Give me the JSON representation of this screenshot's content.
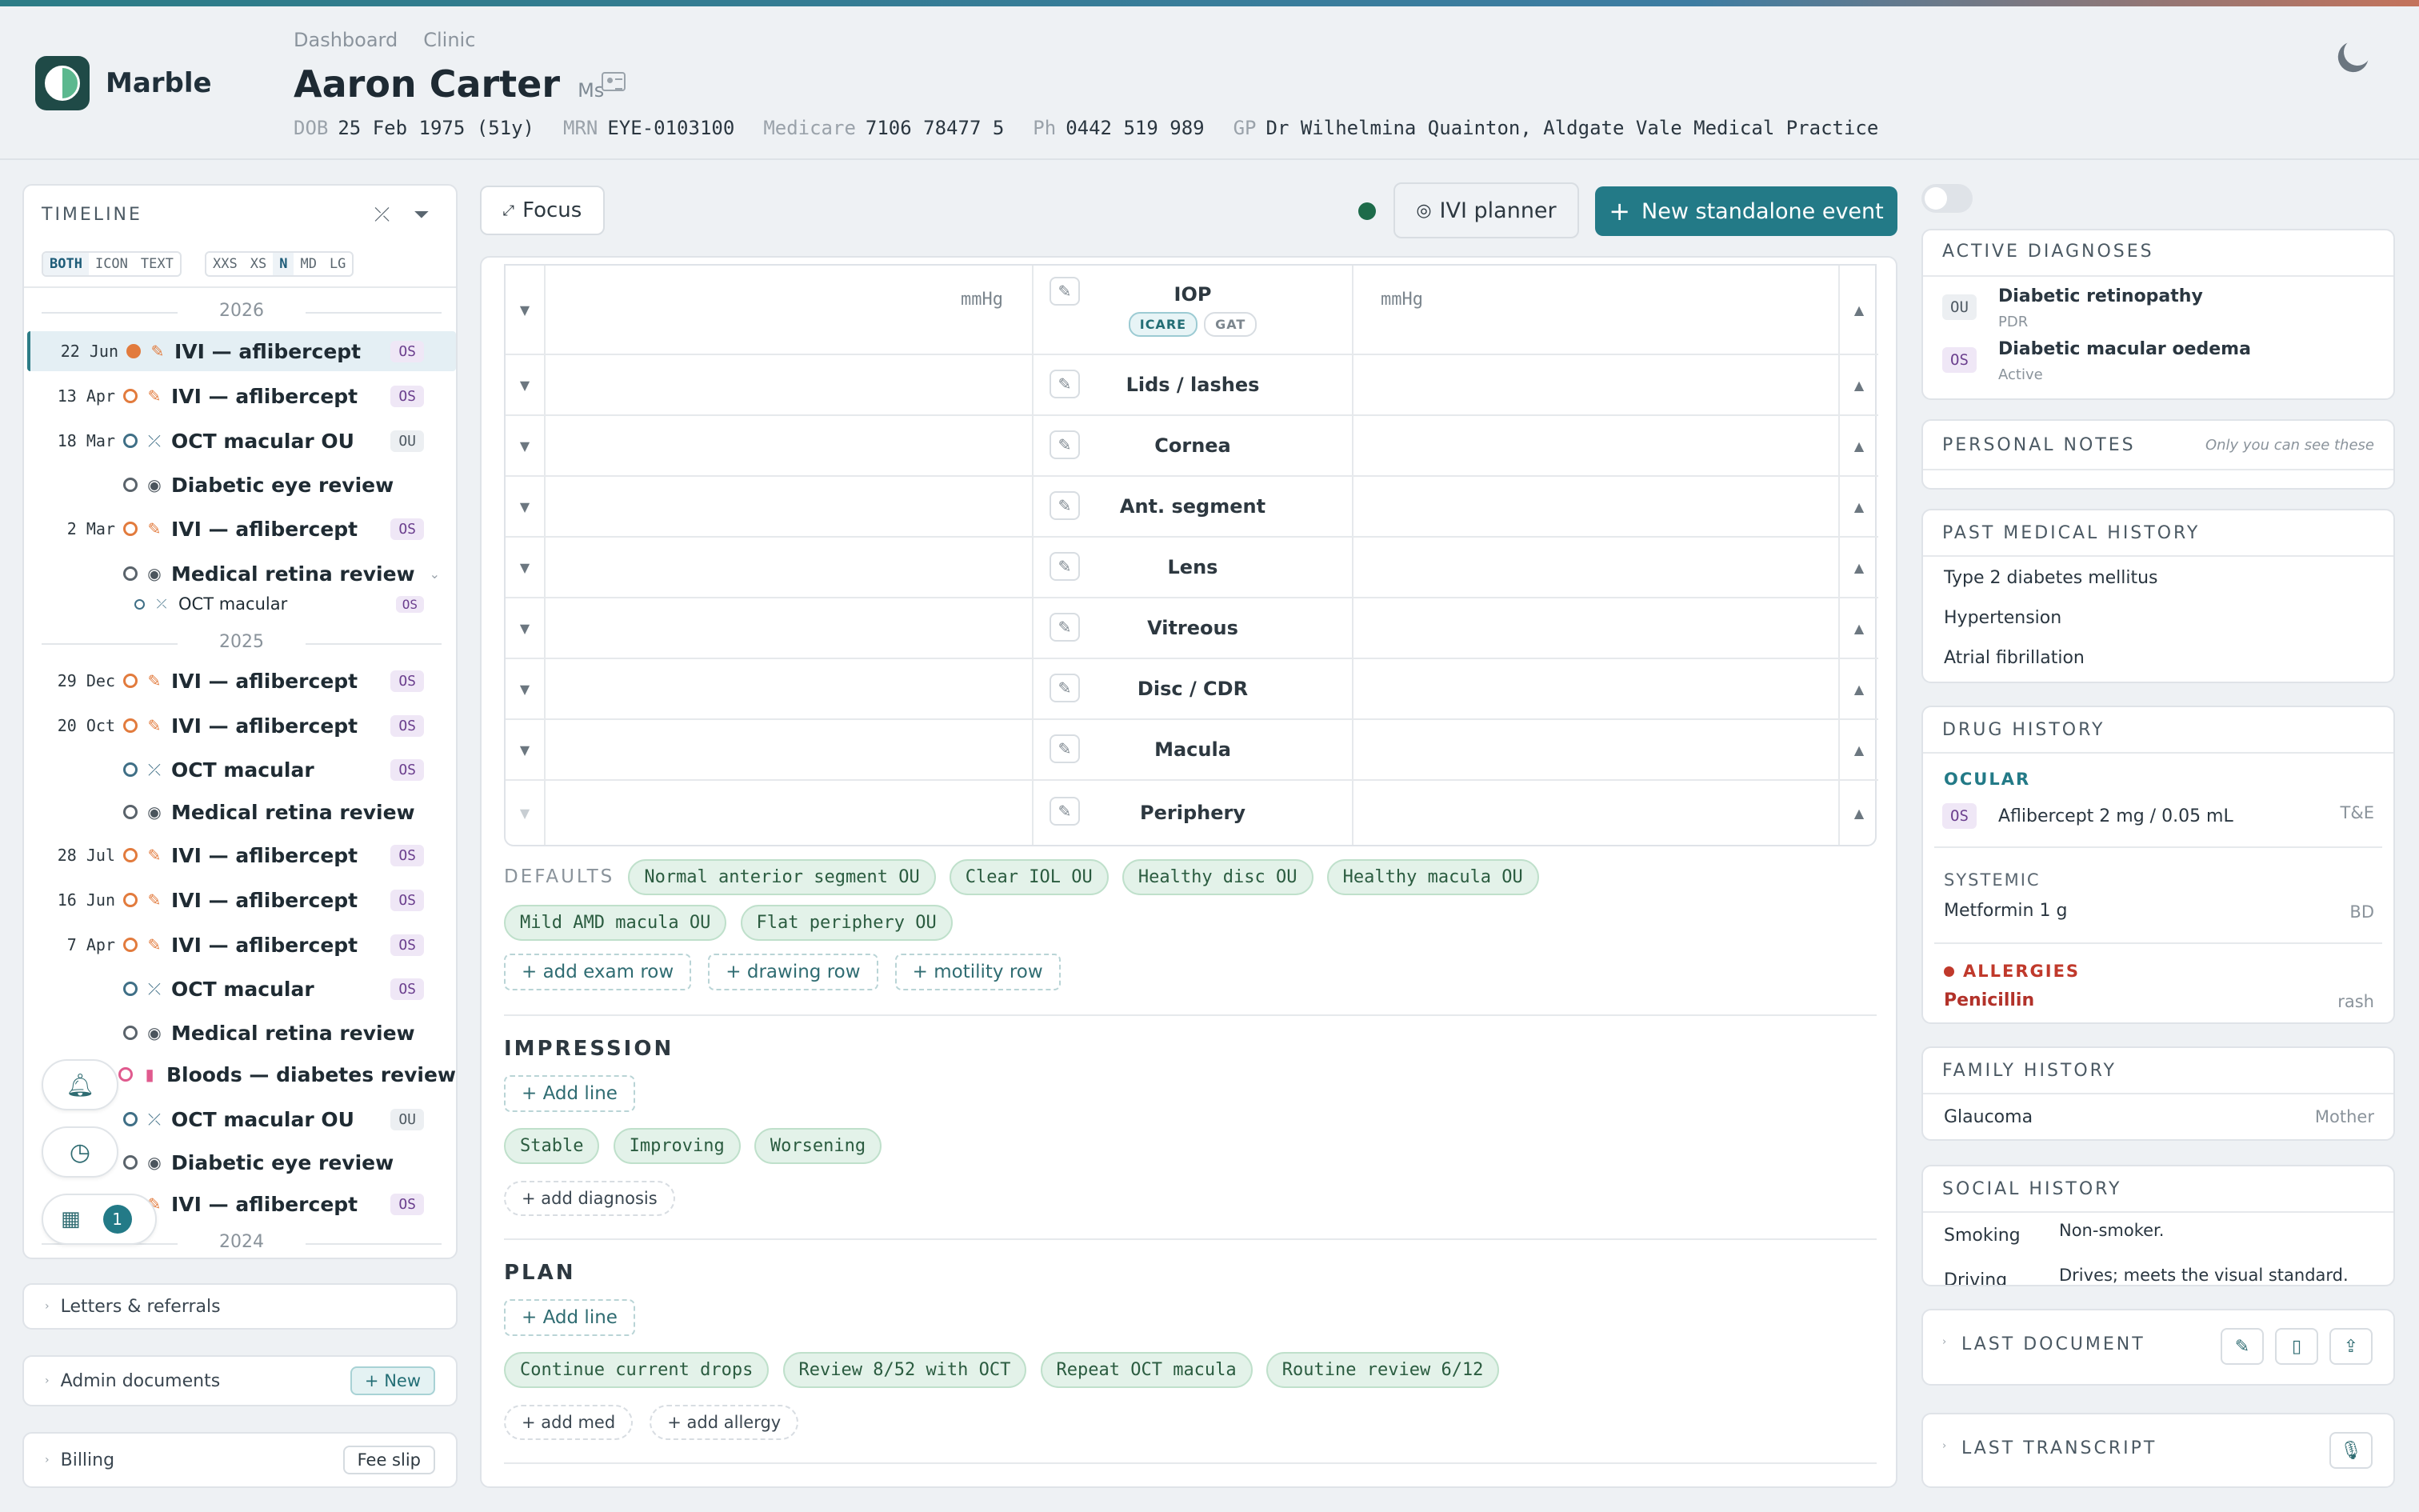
{
  "header": {
    "app_name": "Marble",
    "breadcrumbs": [
      "Dashboard",
      "Clinic"
    ],
    "patient_name": "Aaron Carter",
    "patient_title": "Ms",
    "demographics": [
      {
        "key": "DOB",
        "value": "25 Feb 1975 (51y)"
      },
      {
        "key": "MRN",
        "value": "EYE-0103100"
      },
      {
        "key": "Medicare",
        "value": "7106 78477 5"
      },
      {
        "key": "Ph",
        "value": "0442 519 989"
      },
      {
        "key": "GP",
        "value": "Dr Wilhelmina Quainton, Aldgate Vale Medical Practice"
      }
    ]
  },
  "timeline": {
    "title": "TIMELINE",
    "mode_options": [
      "BOTH",
      "ICON",
      "TEXT"
    ],
    "mode_selected": "BOTH",
    "size_options": [
      "XXS",
      "XS",
      "N",
      "MD",
      "LG"
    ],
    "size_selected": "N",
    "years": [
      "2026",
      "2025",
      "2024"
    ],
    "events": [
      {
        "date": "22 Jun",
        "label": "IVI — aflibercept",
        "eye": "OS"
      },
      {
        "date": "13 Apr",
        "label": "IVI — aflibercept",
        "eye": "OS"
      },
      {
        "date": "18 Mar",
        "label": "OCT macular OU",
        "eye": "OU"
      },
      {
        "date": "",
        "label": "Diabetic eye review",
        "eye": ""
      },
      {
        "date": "2 Mar",
        "label": "IVI — aflibercept",
        "eye": "OS"
      },
      {
        "date": "",
        "label": "Medical retina review",
        "eye": ""
      },
      {
        "date": "",
        "label": "OCT macular",
        "eye": "OS"
      },
      {
        "date": "29 Dec",
        "label": "IVI — aflibercept",
        "eye": "OS"
      },
      {
        "date": "20 Oct",
        "label": "IVI — aflibercept",
        "eye": "OS"
      },
      {
        "date": "",
        "label": "OCT macular",
        "eye": "OS"
      },
      {
        "date": "",
        "label": "Medical retina review",
        "eye": ""
      },
      {
        "date": "28 Jul",
        "label": "IVI — aflibercept",
        "eye": "OS"
      },
      {
        "date": "16 Jun",
        "label": "IVI — aflibercept",
        "eye": "OS"
      },
      {
        "date": "7 Apr",
        "label": "IVI — aflibercept",
        "eye": "OS"
      },
      {
        "date": "",
        "label": "OCT macular",
        "eye": "OS"
      },
      {
        "date": "",
        "label": "Medical retina review",
        "eye": ""
      },
      {
        "date": "",
        "label": "Bloods — diabetes review",
        "eye": ""
      },
      {
        "date": "",
        "label": "OCT macular OU",
        "eye": "OU"
      },
      {
        "date": "",
        "label": "Diabetic eye review",
        "eye": ""
      },
      {
        "date": "",
        "label": "IVI — aflibercept",
        "eye": "OS"
      }
    ],
    "calendar_count": "1"
  },
  "left_sections": {
    "letters": "Letters & referrals",
    "admin": "Admin documents",
    "admin_button": "+ New",
    "billing": "Billing",
    "billing_button": "Fee slip"
  },
  "toolbar": {
    "focus": "Focus",
    "ivi_planner": "IVI planner",
    "new_event": "New standalone event"
  },
  "exam": {
    "unit": "mmHg",
    "iop_label": "IOP",
    "iop_methods": [
      "ICARE",
      "GAT"
    ],
    "rows": [
      "Lids / lashes",
      "Cornea",
      "Ant. segment",
      "Lens",
      "Vitreous",
      "Disc / CDR",
      "Macula",
      "Periphery"
    ],
    "defaults_label": "DEFAULTS",
    "defaults": [
      "Normal anterior segment OU",
      "Clear IOL OU",
      "Healthy disc OU",
      "Healthy macula OU",
      "Mild AMD macula OU",
      "Flat periphery OU"
    ],
    "add_buttons": [
      "+ add exam row",
      "+ drawing row",
      "+ motility row"
    ]
  },
  "impression": {
    "title": "IMPRESSION",
    "add_line": "+ Add line",
    "chips": [
      "Stable",
      "Improving",
      "Worsening"
    ],
    "add_diagnosis": "+ add diagnosis"
  },
  "plan": {
    "title": "PLAN",
    "add_line": "+ Add line",
    "chips": [
      "Continue current drops",
      "Review 8/52 with OCT",
      "Repeat OCT macula",
      "Routine review 6/12"
    ],
    "add_med": "+ add med",
    "add_allergy": "+ add allergy"
  },
  "right": {
    "active_diagnoses": {
      "title": "ACTIVE DIAGNOSES",
      "items": [
        {
          "eye": "OU",
          "name": "Diabetic retinopathy",
          "status": "PDR"
        },
        {
          "eye": "OS",
          "name": "Diabetic macular oedema",
          "status": "Active"
        }
      ]
    },
    "personal_notes": {
      "title": "PERSONAL NOTES",
      "hint": "Only you can see these"
    },
    "pmh": {
      "title": "PAST MEDICAL HISTORY",
      "items": [
        "Type 2 diabetes mellitus",
        "Hypertension",
        "Atrial fibrillation"
      ]
    },
    "drug_history": {
      "title": "DRUG HISTORY",
      "ocular_label": "OCULAR",
      "ocular": {
        "eye": "OS",
        "name": "Aflibercept 2 mg / 0.05 mL",
        "regimen": "T&E"
      },
      "systemic_label": "SYSTEMIC",
      "systemic": {
        "name": "Metformin 1 g",
        "freq": "BD"
      },
      "allergies_label": "ALLERGIES",
      "allergy": {
        "name": "Penicillin",
        "reaction": "rash"
      }
    },
    "family_history": {
      "title": "FAMILY HISTORY",
      "item": "Glaucoma",
      "relation": "Mother"
    },
    "social_history": {
      "title": "SOCIAL HISTORY",
      "rows": [
        {
          "key": "Smoking",
          "value": "Non-smoker."
        },
        {
          "key": "Driving",
          "value": "Drives; meets the visual standard."
        }
      ]
    },
    "last_document": "LAST DOCUMENT",
    "last_transcript": "LAST TRANSCRIPT"
  },
  "colors": {
    "accent": "#237a87",
    "os_badge": "#efe7f6",
    "ivi_orange": "#e27b3d",
    "allergy_red": "#c0392b",
    "chip_green": "#e3f2e9"
  }
}
